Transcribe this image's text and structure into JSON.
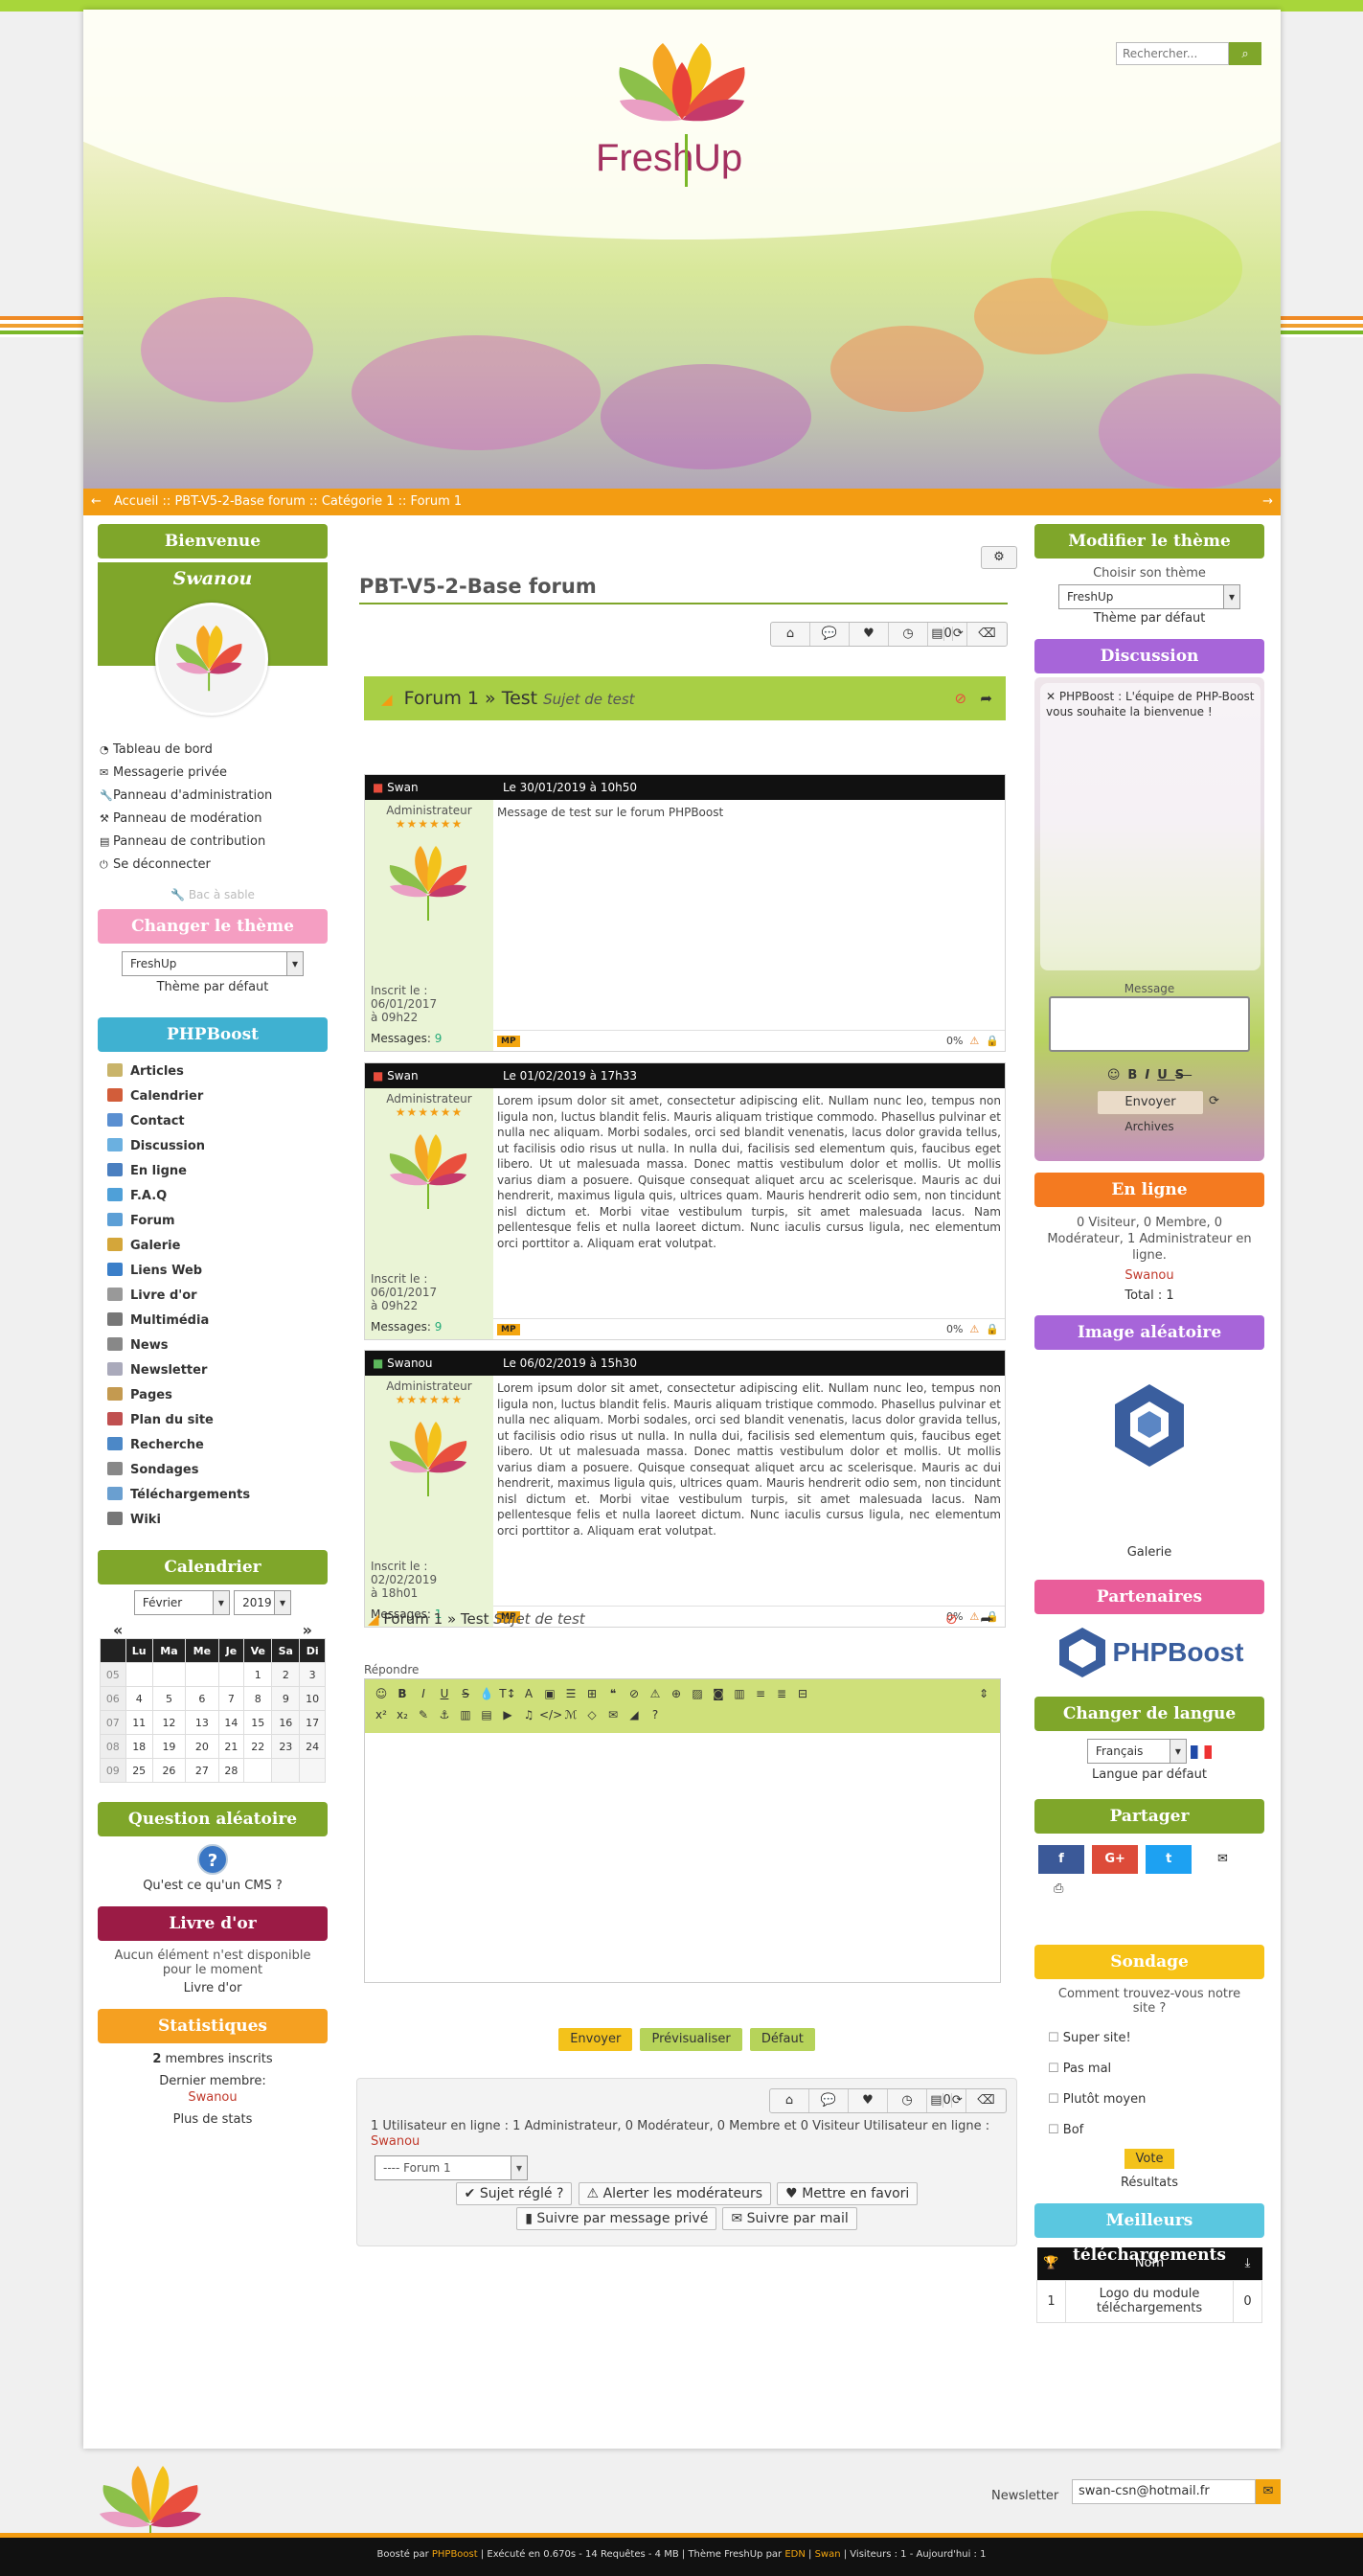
{
  "header": {
    "brand": "Fresh Up",
    "search_placeholder": "Rechercher...",
    "breadcrumb": "Accueil :: PBT-V5-2-Base forum :: Catégorie 1 :: Forum 1"
  },
  "left": {
    "welcome": {
      "title": "Bienvenue",
      "username": "Swanou",
      "links": [
        "Tableau de bord",
        "Messagerie privée",
        "Panneau d'administration",
        "Panneau de modération",
        "Panneau de contribution",
        "Se déconnecter"
      ],
      "sandbox": "Bac à sable"
    },
    "theme": {
      "title": "Changer le thème",
      "selected": "FreshUp",
      "default_label": "Thème par défaut"
    },
    "phpboost": {
      "title": "PHPBoost",
      "items": [
        "Articles",
        "Calendrier",
        "Contact",
        "Discussion",
        "En ligne",
        "F.A.Q",
        "Forum",
        "Galerie",
        "Liens Web",
        "Livre d'or",
        "Multimédia",
        "News",
        "Newsletter",
        "Pages",
        "Plan du site",
        "Recherche",
        "Sondages",
        "Téléchargements",
        "Wiki"
      ]
    },
    "calendar": {
      "title": "Calendrier",
      "month": "Février",
      "year": "2019",
      "prev": "«",
      "next": "»",
      "days": [
        "Lu",
        "Ma",
        "Me",
        "Je",
        "Ve",
        "Sa",
        "Di"
      ],
      "weeks": [
        [
          "05",
          "",
          "",
          "",
          "",
          "1",
          "2",
          "3"
        ],
        [
          "06",
          "4",
          "5",
          "6",
          "7",
          "8",
          "9",
          "10"
        ],
        [
          "07",
          "11",
          "12",
          "13",
          "14",
          "15",
          "16",
          "17"
        ],
        [
          "08",
          "18",
          "19",
          "20",
          "21",
          "22",
          "23",
          "24"
        ],
        [
          "09",
          "25",
          "26",
          "27",
          "28",
          "",
          "",
          ""
        ]
      ]
    },
    "question": {
      "title": "Question aléatoire",
      "icon": "?",
      "text": "Qu'est ce qu'un CMS ?"
    },
    "guestbook": {
      "title": "Livre d'or",
      "empty": "Aucun élément n'est disponible pour le moment",
      "link": "Livre d'or"
    },
    "stats": {
      "title": "Statistiques",
      "members_count": "2",
      "members_label": " membres inscrits",
      "last_label": "Dernier membre:",
      "last_member": "Swanou",
      "more": "Plus de stats"
    }
  },
  "main": {
    "page_title": "PBT-V5-2-Base forum",
    "topic_bar": {
      "forum": "Forum 1",
      "sep": " » ",
      "topic": "Test",
      "subtitle": "Sujet de test"
    },
    "action_count": "0",
    "posts": [
      {
        "author": "Swan",
        "date": "Le 30/01/2019 à 10h50",
        "rank": "Administrateur",
        "stars": "★★★★★★",
        "registered": "Inscrit le : 06/01/2017 à 09h22",
        "messages_label": "Messages: ",
        "messages": "9",
        "content": "Message de test sur le forum PHPBoost",
        "mp": "MP",
        "pct": "0%",
        "online": false
      },
      {
        "author": "Swan",
        "date": "Le 01/02/2019 à 17h33",
        "rank": "Administrateur",
        "stars": "★★★★★★",
        "registered": "Inscrit le : 06/01/2017 à 09h22",
        "messages_label": "Messages: ",
        "messages": "9",
        "content": "Lorem ipsum dolor sit amet, consectetur adipiscing elit. Nullam nunc leo, tempus non ligula non, luctus blandit felis. Mauris aliquam tristique commodo. Phasellus pulvinar et nulla nec aliquam. Morbi sodales, orci sed blandit venenatis, lacus dolor gravida tellus, ut facilisis odio risus ut nulla. In nulla dui, facilisis sed elementum quis, faucibus eget libero. Ut ut malesuada massa. Donec mattis vestibulum dolor et mollis. Ut mollis varius diam a posuere. Quisque consequat aliquet arcu ac scelerisque. Mauris ac dui hendrerit, maximus ligula quis, ultrices quam. Mauris hendrerit odio sem, non tincidunt nisl dictum et. Morbi vitae vestibulum turpis, sit amet malesuada lacus. Nam pellentesque felis et nulla laoreet dictum. Nunc iaculis cursus ligula, nec elementum orci porttitor a. Aliquam erat volutpat.",
        "mp": "MP",
        "pct": "0%",
        "online": false
      },
      {
        "author": "Swanou",
        "date": "Le 06/02/2019 à 15h30",
        "rank": "Administrateur",
        "stars": "★★★★★★",
        "registered": "Inscrit le : 02/02/2019 à 18h01",
        "messages_label": "Messages: ",
        "messages": "1",
        "content": "Lorem ipsum dolor sit amet, consectetur adipiscing elit. Nullam nunc leo, tempus non ligula non, luctus blandit felis. Mauris aliquam tristique commodo. Phasellus pulvinar et nulla nec aliquam. Morbi sodales, orci sed blandit venenatis, lacus dolor gravida tellus, ut facilisis odio risus ut nulla. In nulla dui, facilisis sed elementum quis, faucibus eget libero. Ut ut malesuada massa. Donec mattis vestibulum dolor et mollis. Ut mollis varius diam a posuere. Quisque consequat aliquet arcu ac scelerisque. Mauris ac dui hendrerit, maximus ligula quis, ultrices quam. Mauris hendrerit odio sem, non tincidunt nisl dictum et. Morbi vitae vestibulum turpis, sit amet malesuada lacus. Nam pellentesque felis et nulla laoreet dictum. Nunc iaculis cursus ligula, nec elementum orci porttitor a. Aliquam erat volutpat.",
        "mp": "MP",
        "pct": "0%",
        "online": true
      }
    ],
    "reply_label": "Répondre",
    "buttons": {
      "send": "Envoyer",
      "preview": "Prévisualiser",
      "default": "Défaut"
    },
    "online_text": "1 Utilisateur en ligne : 1 Administrateur, 0 Modérateur, 0 Membre et 0 Visiteur Utilisateur en ligne :",
    "online_user": "Swanou",
    "forum_select": "---- Forum 1",
    "actions": {
      "solved": "Sujet réglé ?",
      "alert": "Alerter les modérateurs",
      "fav": "Mettre en favori",
      "pm": "Suivre par message privé",
      "mail": "Suivre par mail"
    }
  },
  "right": {
    "theme": {
      "title": "Modifier le thème",
      "choose": "Choisir son thème",
      "selected": "FreshUp",
      "default_label": "Thème par défaut"
    },
    "discussion": {
      "title": "Discussion",
      "close": "✕",
      "author": "PHPBoost",
      "message": " : L'équipe de PHP-Boost vous souhaite la bienvenue !",
      "msg_label": "Message",
      "send": "Envoyer",
      "archives": "Archives"
    },
    "online": {
      "title": "En ligne",
      "text": "0 Visiteur, 0 Membre, 0 Modérateur, 1 Administrateur en ligne.",
      "user": "Swanou",
      "total": "Total : 1"
    },
    "random_image": {
      "title": "Image aléatoire",
      "caption": "Galerie"
    },
    "partners": {
      "title": "Partenaires",
      "logo_text": "PHPBoost"
    },
    "language": {
      "title": "Changer de langue",
      "selected": "Français",
      "default_label": "Langue par défaut"
    },
    "share": {
      "title": "Partager",
      "fb": "f",
      "gp": "G+",
      "tw": "t"
    },
    "poll": {
      "title": "Sondage",
      "question": "Comment trouvez-vous notre site ?",
      "options": [
        "Super site!",
        "Pas mal",
        "Plutôt moyen",
        "Bof"
      ],
      "vote": "Vote",
      "results": "Résultats"
    },
    "downloads": {
      "title": "Meilleurs téléchargements",
      "col_name": "Nom",
      "row_rank": "1",
      "row_name": "Logo du module téléchargements",
      "row_count": "0"
    }
  },
  "footer": {
    "newsletter_label": "Newsletter",
    "newsletter_value": "swan-csn@hotmail.fr",
    "credits": {
      "boosted": "Boosté par ",
      "phpboost": "PHPBoost",
      "exec": " | Exécuté en 0.670s - 14 Requêtes - 4 MB | Thème FreshUp par ",
      "edn": "EDN",
      "sep": " | ",
      "swan": "Swan",
      "visitors": " |  Visiteurs : 1 - Aujourd'hui : 1"
    }
  },
  "colors": {
    "green": "#7fa62a",
    "orange": "#f39c12",
    "lime": "#a8cf45"
  }
}
